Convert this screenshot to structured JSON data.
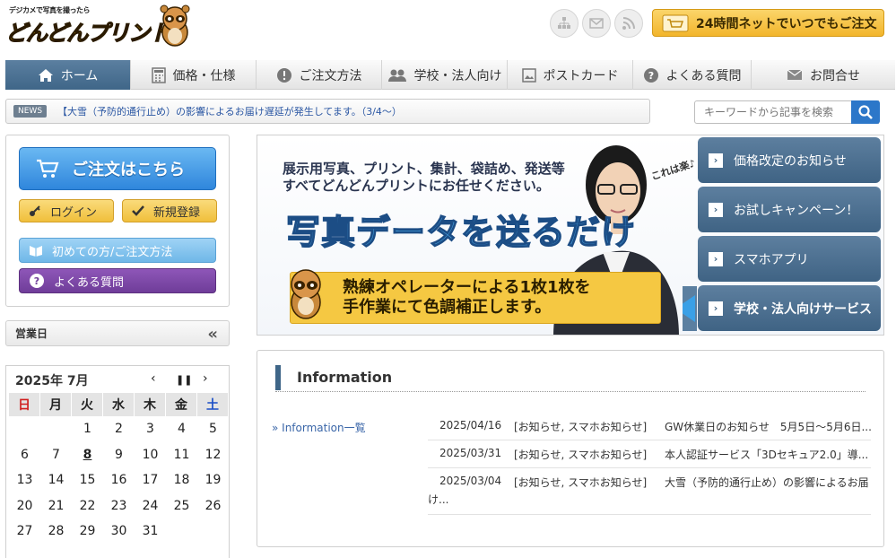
{
  "header": {
    "logo_tagline": "デジカメで写真を撮ったら",
    "logo_text": "どんどんプリント",
    "icons": [
      "sitemap-icon",
      "mail-icon",
      "rss-icon"
    ],
    "order_banner": "24時間ネットでいつでもご注文"
  },
  "nav": [
    {
      "label": "ホーム",
      "icon": "home-icon",
      "active": true
    },
    {
      "label": "価格・仕様",
      "icon": "calculator-icon"
    },
    {
      "label": "ご注文方法",
      "icon": "info-icon"
    },
    {
      "label": "学校・法人向け",
      "icon": "people-icon"
    },
    {
      "label": "ポストカード",
      "icon": "postcard-icon"
    },
    {
      "label": "よくある質問",
      "icon": "question-icon"
    },
    {
      "label": "お問合せ",
      "icon": "envelope-icon"
    }
  ],
  "news": {
    "badge": "NEWS",
    "text": "【大雪（予防的通行止め）の影響によるお届け遅延が発生してます。（3/4～）"
  },
  "search": {
    "placeholder": "キーワードから記事を検索"
  },
  "left": {
    "order_button": "ご注文はこちら",
    "login": "ログイン",
    "register": "新規登録",
    "guide": "初めての方/ご注文方法",
    "faq": "よくある質問"
  },
  "calendar": {
    "header": "営業日",
    "month_title": "2025年 7月",
    "dow": [
      "日",
      "月",
      "火",
      "水",
      "木",
      "金",
      "土"
    ],
    "weeks": [
      [
        "",
        "",
        "1",
        "2",
        "3",
        "4",
        "5"
      ],
      [
        "6",
        "7",
        "8",
        "9",
        "10",
        "11",
        "12"
      ],
      [
        "13",
        "14",
        "15",
        "16",
        "17",
        "18",
        "19"
      ],
      [
        "20",
        "21",
        "22",
        "23",
        "24",
        "25",
        "26"
      ],
      [
        "27",
        "28",
        "29",
        "30",
        "31",
        "",
        ""
      ]
    ],
    "today": "8"
  },
  "hero": {
    "sub1": "展示用写真、プリント、集計、袋詰め、発送等",
    "sub2": "すべてどんどんプリントにお任せください。",
    "main": "写真データを送るだけ",
    "ribbon1": "熟練オペレーターによる1枚1枚を",
    "ribbon2": "手作業にて色調補正します。",
    "tag": "これは楽♪"
  },
  "side_links": [
    "価格改定のお知らせ",
    "お試しキャンペーン！",
    "スマホアプリ",
    "学校・法人向けサービス"
  ],
  "information": {
    "title": "Information",
    "all_link": "» Information一覧",
    "items": [
      {
        "date": "2025/04/16",
        "cat": "[お知らせ, スマホお知らせ]",
        "title": "GW休業日のお知らせ　5月5日～5月6日..."
      },
      {
        "date": "2025/03/31",
        "cat": "[お知らせ, スマホお知らせ]",
        "title": "本人認証サービス「3Dセキュア2.0」導..."
      },
      {
        "date": "2025/03/04",
        "cat": "[お知らせ, スマホお知らせ]",
        "title": "大雪（予防的通行止め）の影響によるお届",
        "title2": "け..."
      }
    ]
  },
  "colors": {
    "nav_active": "#4a7093",
    "order_btn": "#2f86dc",
    "accent_yellow": "#f2b52c",
    "purple": "#6f3d99"
  }
}
